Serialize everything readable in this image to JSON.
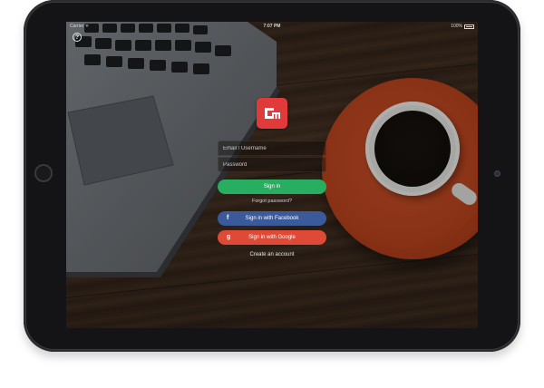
{
  "status_bar": {
    "carrier": "Carrier ᯤ",
    "time": "7:07 PM",
    "battery": "100%",
    "battery_level": 1.0
  },
  "help": {
    "icon": "question-circle-icon",
    "glyph": "?"
  },
  "logo": {
    "icon": "app-logo-icon",
    "color": "#e03a3a"
  },
  "form": {
    "email_placeholder": "Email / Username",
    "password_placeholder": "Password"
  },
  "buttons": {
    "signin_label": "Sign in",
    "signin_color": "#27ae60",
    "facebook_label": "Sign in with Facebook",
    "facebook_icon": "f",
    "facebook_color": "#3b5a9a",
    "google_label": "Sign in with Google",
    "google_icon": "g",
    "google_color": "#de4a35"
  },
  "links": {
    "forgot": "Forgot password?",
    "create": "Create an account"
  }
}
